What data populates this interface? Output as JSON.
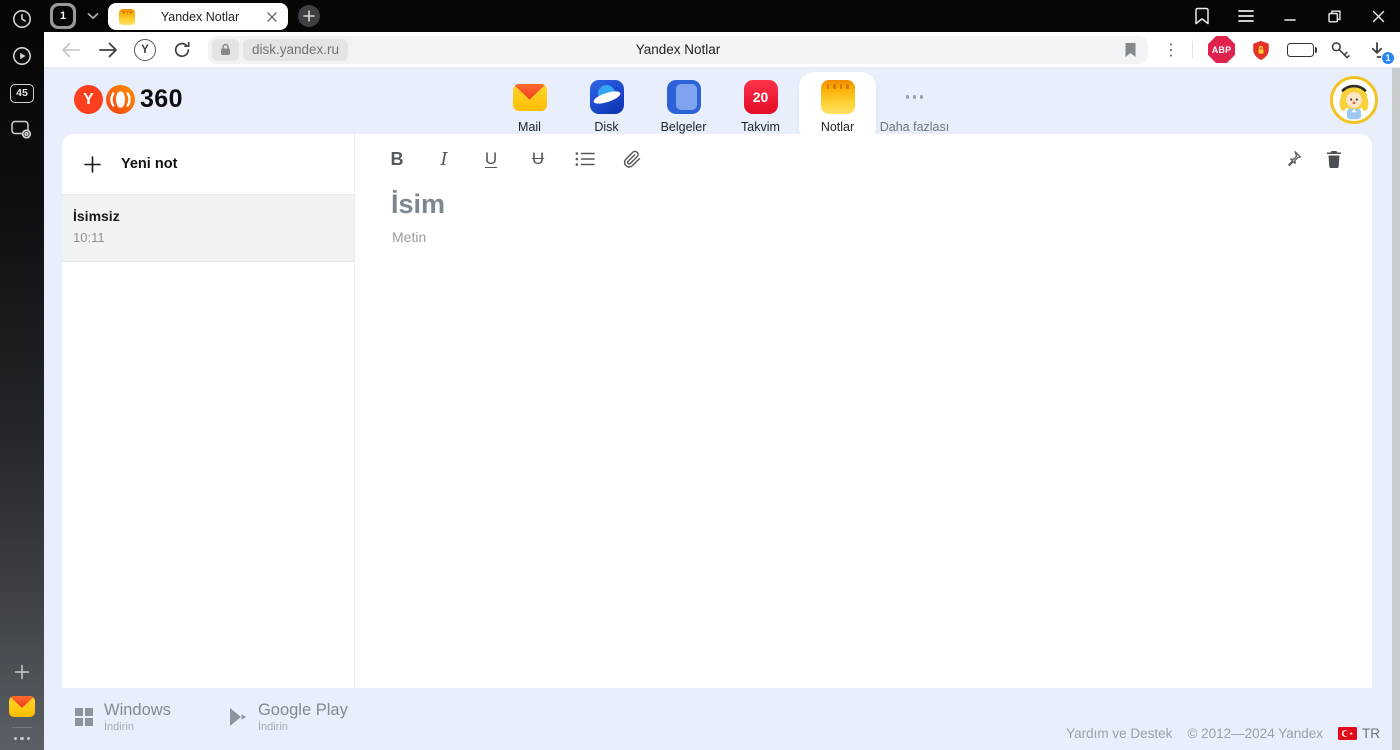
{
  "browser": {
    "sidebar": {
      "counter_badge": "45"
    },
    "tabbar": {
      "tab_count": "1",
      "active_tab_title": "Yandex Notlar"
    },
    "navbar": {
      "yandex_button_letter": "Y",
      "url": "disk.yandex.ru",
      "page_title": "Yandex Notlar",
      "adblock_label": "ABP",
      "download_badge": "1"
    }
  },
  "header": {
    "logo": {
      "letter": "Y",
      "suffix": "360"
    },
    "apps": [
      {
        "label": "Mail"
      },
      {
        "label": "Disk"
      },
      {
        "label": "Belgeler"
      },
      {
        "label": "Takvim",
        "badge": "20"
      },
      {
        "label": "Notlar"
      },
      {
        "label": "Daha fazlası"
      }
    ]
  },
  "notes_panel": {
    "new_note_label": "Yeni not",
    "notes": [
      {
        "title": "İsimsiz",
        "time": "10:11"
      }
    ]
  },
  "editor": {
    "toolbar": {
      "bold": "B",
      "italic": "I",
      "underline": "U",
      "strikethrough": "U"
    },
    "title_placeholder": "İsim",
    "body_placeholder": "Metin"
  },
  "footer": {
    "downloads": [
      {
        "platform": "Windows",
        "action": "İndirin"
      },
      {
        "platform": "Google Play",
        "action": "İndirin"
      }
    ],
    "help_label": "Yardım ve Destek",
    "copyright": "© 2012—2024 Yandex",
    "locale": "TR"
  },
  "colors": {
    "page_background": "#e8eefb",
    "yandex_red": "#fc3f1d",
    "calendar_red": "#ea0f2e",
    "notes_yellow": "#ffd43b",
    "avatar_ring": "#f2c423"
  }
}
